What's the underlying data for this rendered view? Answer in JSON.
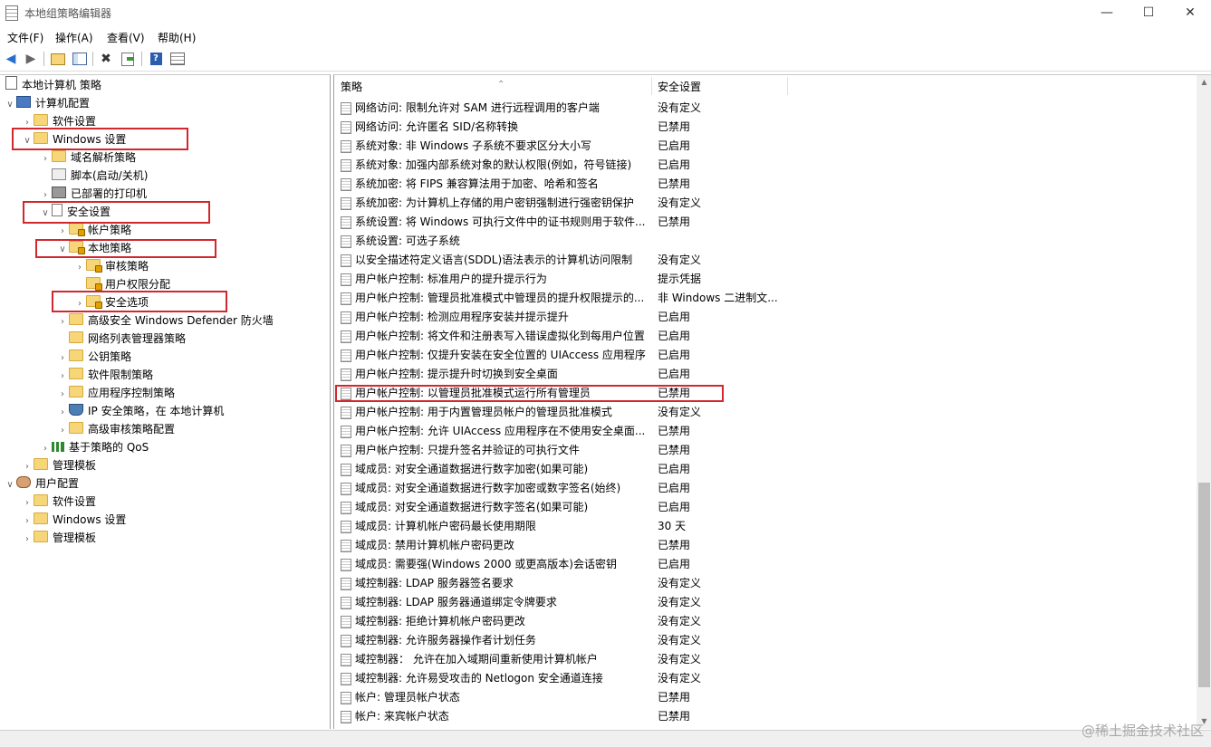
{
  "window": {
    "title": "本地组策略编辑器",
    "minimize": "—",
    "maximize": "☐",
    "close": "✕"
  },
  "menu": [
    "文件(F)",
    "操作(A)",
    "查看(V)",
    "帮助(H)"
  ],
  "toolbar": {
    "icons": [
      "back-arrow-icon",
      "forward-arrow-icon",
      "up-folder-icon",
      "show-hide-tree-icon",
      "delete-icon",
      "export-list-icon",
      "help-icon",
      "properties-icon"
    ]
  },
  "tree": [
    {
      "label": "本地计算机 策略",
      "level": 0,
      "chevron": "",
      "icon": "root"
    },
    {
      "label": "计算机配置",
      "level": 0,
      "chevron": "v",
      "icon": "computer"
    },
    {
      "label": "软件设置",
      "level": 1,
      "chevron": ">",
      "icon": "folder"
    },
    {
      "label": "Windows 设置",
      "level": 1,
      "chevron": "v",
      "icon": "folder"
    },
    {
      "label": "域名解析策略",
      "level": 2,
      "chevron": ">",
      "icon": "folder"
    },
    {
      "label": "脚本(启动/关机)",
      "level": 2,
      "chevron": "",
      "icon": "script"
    },
    {
      "label": "已部署的打印机",
      "level": 2,
      "chevron": ">",
      "icon": "printer"
    },
    {
      "label": "安全设置",
      "level": 2,
      "chevron": "v",
      "icon": "policy"
    },
    {
      "label": "帐户策略",
      "level": 3,
      "chevron": ">",
      "icon": "folder-lock"
    },
    {
      "label": "本地策略",
      "level": 3,
      "chevron": "v",
      "icon": "folder-lock"
    },
    {
      "label": "审核策略",
      "level": 4,
      "chevron": ">",
      "icon": "folder-lock"
    },
    {
      "label": "用户权限分配",
      "level": 4,
      "chevron": "",
      "icon": "folder-lock"
    },
    {
      "label": "安全选项",
      "level": 4,
      "chevron": ">",
      "icon": "folder-lock"
    },
    {
      "label": "高级安全 Windows Defender 防火墙",
      "level": 3,
      "chevron": ">",
      "icon": "folder"
    },
    {
      "label": "网络列表管理器策略",
      "level": 3,
      "chevron": "",
      "icon": "folder"
    },
    {
      "label": "公钥策略",
      "level": 3,
      "chevron": ">",
      "icon": "folder"
    },
    {
      "label": "软件限制策略",
      "level": 3,
      "chevron": ">",
      "icon": "folder"
    },
    {
      "label": "应用程序控制策略",
      "level": 3,
      "chevron": ">",
      "icon": "folder"
    },
    {
      "label": "IP 安全策略，在 本地计算机",
      "level": 3,
      "chevron": ">",
      "icon": "shield"
    },
    {
      "label": "高级审核策略配置",
      "level": 3,
      "chevron": ">",
      "icon": "folder"
    },
    {
      "label": "基于策略的 QoS",
      "level": 2,
      "chevron": ">",
      "icon": "barchart"
    },
    {
      "label": "管理模板",
      "level": 1,
      "chevron": ">",
      "icon": "folder"
    },
    {
      "label": "用户配置",
      "level": 0,
      "chevron": "v",
      "icon": "user"
    },
    {
      "label": "软件设置",
      "level": 1,
      "chevron": ">",
      "icon": "folder"
    },
    {
      "label": "Windows 设置",
      "level": 1,
      "chevron": ">",
      "icon": "folder"
    },
    {
      "label": "管理模板",
      "level": 1,
      "chevron": ">",
      "icon": "folder"
    }
  ],
  "list": {
    "columns": [
      "策略",
      "安全设置"
    ],
    "rows": [
      {
        "policy": "网络访问: 限制允许对 SAM 进行远程调用的客户端",
        "setting": "没有定义"
      },
      {
        "policy": "网络访问: 允许匿名 SID/名称转换",
        "setting": "已禁用"
      },
      {
        "policy": "系统对象: 非 Windows 子系统不要求区分大小写",
        "setting": "已启用"
      },
      {
        "policy": "系统对象: 加强内部系统对象的默认权限(例如，符号链接)",
        "setting": "已启用"
      },
      {
        "policy": "系统加密: 将 FIPS 兼容算法用于加密、哈希和签名",
        "setting": "已禁用"
      },
      {
        "policy": "系统加密: 为计算机上存储的用户密钥强制进行强密钥保护",
        "setting": "没有定义"
      },
      {
        "policy": "系统设置: 将 Windows 可执行文件中的证书规则用于软件...",
        "setting": "已禁用"
      },
      {
        "policy": "系统设置: 可选子系统",
        "setting": ""
      },
      {
        "policy": "以安全描述符定义语言(SDDL)语法表示的计算机访问限制",
        "setting": "没有定义"
      },
      {
        "policy": "用户帐户控制: 标准用户的提升提示行为",
        "setting": "提示凭据"
      },
      {
        "policy": "用户帐户控制: 管理员批准模式中管理员的提升权限提示的...",
        "setting": "非 Windows 二进制文..."
      },
      {
        "policy": "用户帐户控制: 检测应用程序安装并提示提升",
        "setting": "已启用"
      },
      {
        "policy": "用户帐户控制: 将文件和注册表写入错误虚拟化到每用户位置",
        "setting": "已启用"
      },
      {
        "policy": "用户帐户控制: 仅提升安装在安全位置的 UIAccess 应用程序",
        "setting": "已启用"
      },
      {
        "policy": "用户帐户控制: 提示提升时切换到安全桌面",
        "setting": "已启用"
      },
      {
        "policy": "用户帐户控制: 以管理员批准模式运行所有管理员",
        "setting": "已禁用"
      },
      {
        "policy": "用户帐户控制: 用于内置管理员帐户的管理员批准模式",
        "setting": "没有定义"
      },
      {
        "policy": "用户帐户控制: 允许 UIAccess 应用程序在不使用安全桌面...",
        "setting": "已禁用"
      },
      {
        "policy": "用户帐户控制: 只提升签名并验证的可执行文件",
        "setting": "已禁用"
      },
      {
        "policy": "域成员: 对安全通道数据进行数字加密(如果可能)",
        "setting": "已启用"
      },
      {
        "policy": "域成员: 对安全通道数据进行数字加密或数字签名(始终)",
        "setting": "已启用"
      },
      {
        "policy": "域成员: 对安全通道数据进行数字签名(如果可能)",
        "setting": "已启用"
      },
      {
        "policy": "域成员: 计算机帐户密码最长使用期限",
        "setting": "30 天"
      },
      {
        "policy": "域成员: 禁用计算机帐户密码更改",
        "setting": "已禁用"
      },
      {
        "policy": "域成员: 需要强(Windows 2000 或更高版本)会话密钥",
        "setting": "已启用"
      },
      {
        "policy": "域控制器: LDAP 服务器签名要求",
        "setting": "没有定义"
      },
      {
        "policy": "域控制器: LDAP 服务器通道绑定令牌要求",
        "setting": "没有定义"
      },
      {
        "policy": "域控制器: 拒绝计算机帐户密码更改",
        "setting": "没有定义"
      },
      {
        "policy": "域控制器: 允许服务器操作者计划任务",
        "setting": "没有定义"
      },
      {
        "policy": "域控制器：  允许在加入域期间重新使用计算机帐户",
        "setting": "没有定义"
      },
      {
        "policy": "域控制器: 允许易受攻击的 Netlogon 安全通道连接",
        "setting": "没有定义"
      },
      {
        "policy": "帐户: 管理员帐户状态",
        "setting": "已禁用"
      },
      {
        "policy": "帐户: 来宾帐户状态",
        "setting": "已禁用"
      }
    ]
  },
  "watermark": "@稀土掘金技术社区"
}
